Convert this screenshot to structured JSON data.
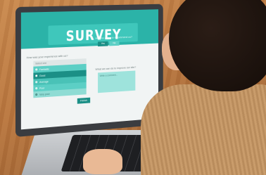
{
  "survey": {
    "title": "SURVEY",
    "q1": "How was your experience with us?",
    "q2": "Are you going to recommend us?",
    "q3": "What we can do to improve our site?",
    "list_header": "Select one",
    "options": [
      "Fantastic",
      "Good",
      "Average",
      "Poor",
      "Very poor"
    ],
    "selected_option": "Good",
    "yes_label": "Yes",
    "no_label": "No",
    "comment_placeholder": "Write a comment...",
    "finish_label": "Finish"
  },
  "colors": {
    "accent": "#2bb3a8",
    "accent_dark": "#1b8f86",
    "screen_bg": "#f1f4f4"
  }
}
